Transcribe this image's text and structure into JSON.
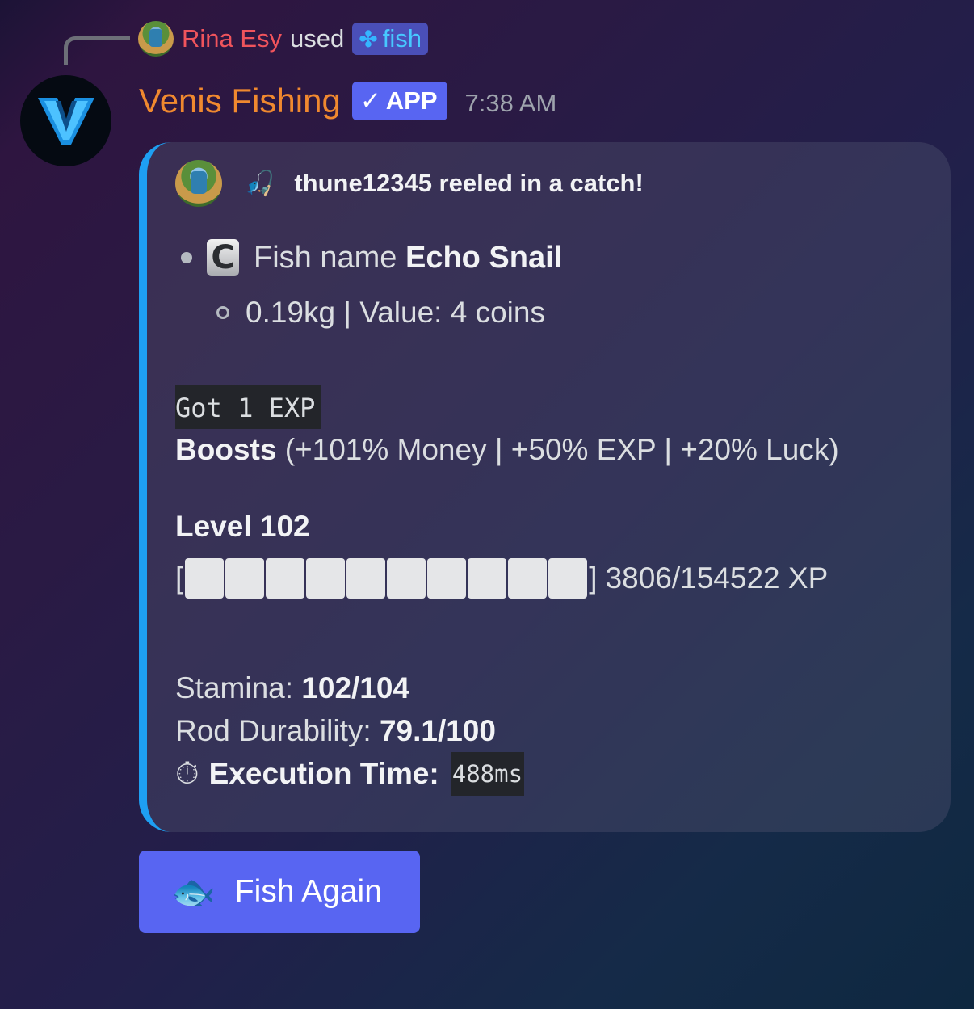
{
  "reply": {
    "user_name": "Rina Esy",
    "used_text": "used",
    "command": "fish"
  },
  "message": {
    "bot_name": "Venis Fishing",
    "badge": "APP",
    "time": "7:38 AM"
  },
  "embed": {
    "author": "thune12345 reeled in a catch!",
    "fish_label": "Fish name",
    "fish_name": "Echo Snail",
    "weight_value": "0.19kg | Value: 4 coins",
    "exp_code": "Got 1 EXP",
    "boosts_label": "Boosts",
    "boosts_value": "(+101% Money | +50% EXP | +20% Luck)",
    "level": "Level 102",
    "xp_text": "3806/154522 XP",
    "xp_progress": 0.0246,
    "stamina_label": "Stamina:",
    "stamina_value": "102/104",
    "rod_label": "Rod Durability:",
    "rod_value": "79.1/100",
    "exec_label": "Execution Time:",
    "exec_value": "488ms"
  },
  "button": {
    "label": "Fish Again"
  },
  "icons": {
    "command": "clover-icon",
    "badge": "checkmark-icon",
    "author_emoji": "fishing-rod-icon",
    "rarity": "rarity-c-icon",
    "exec_emoji": "stopwatch-icon",
    "button_emoji": "fish-hook-icon"
  },
  "colors": {
    "reply_name": "#f0545c",
    "bot_name": "#f0892f",
    "accent": "#5865f2",
    "embed_border": "#1e9ff2"
  }
}
